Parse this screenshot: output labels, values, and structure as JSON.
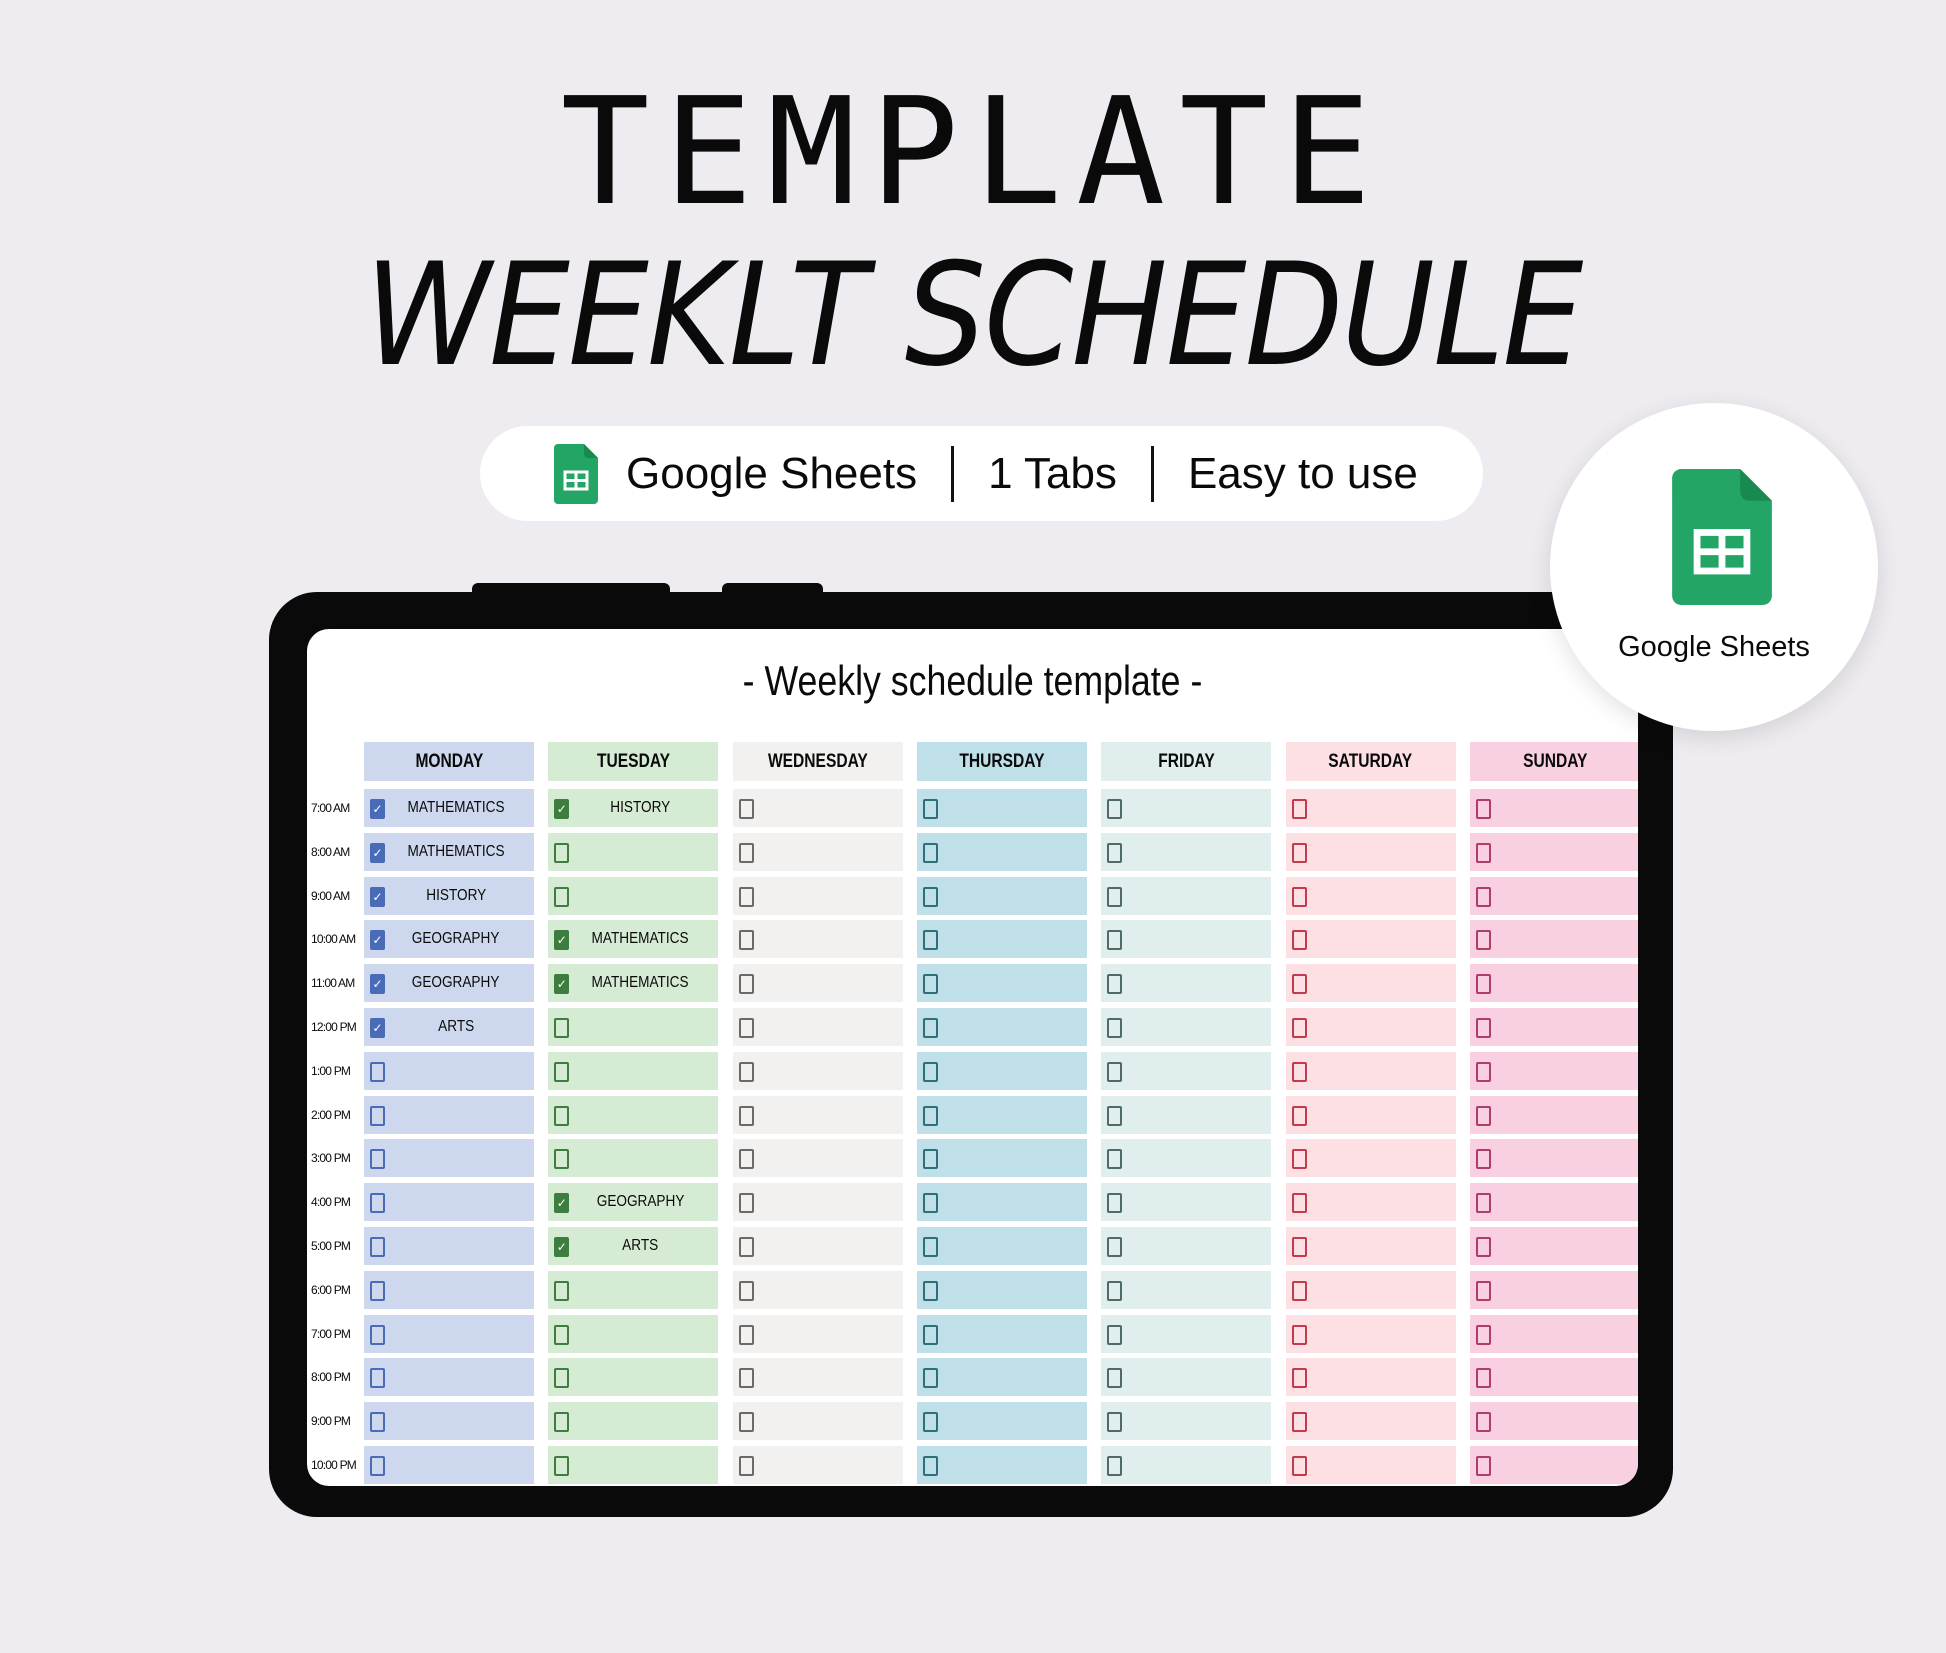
{
  "headline": {
    "line1": "TEMPLATE",
    "line2": "WEEKLT SCHEDULE"
  },
  "features": [
    {
      "icon": "google-sheets-icon",
      "label": "Google Sheets"
    },
    {
      "label": "1 Tabs"
    },
    {
      "label": "Easy to use"
    }
  ],
  "badge": {
    "icon": "google-sheets-icon",
    "label": "Google Sheets"
  },
  "colors": {
    "background": "#efecf1",
    "sheets_green": "#23a566",
    "device": "#0a0a0a"
  },
  "schedule": {
    "title": "- Weekly schedule template -",
    "days": [
      {
        "name": "MONDAY",
        "fill": "#cdd8ee",
        "box": "#4a6cb8"
      },
      {
        "name": "TUESDAY",
        "fill": "#d5ebd3",
        "box": "#3f7d3f"
      },
      {
        "name": "WEDNESDAY",
        "fill": "#f2f1ef",
        "box": "#6a6a6a"
      },
      {
        "name": "THURSDAY",
        "fill": "#bfe0e8",
        "box": "#2f6f7c"
      },
      {
        "name": "FRIDAY",
        "fill": "#e1eeee",
        "box": "#4f6b69"
      },
      {
        "name": "SATURDAY",
        "fill": "#fde0e3",
        "box": "#c23a4b"
      },
      {
        "name": "SUNDAY",
        "fill": "#f9d0e1",
        "box": "#b03c6c"
      }
    ],
    "times": [
      "7:00 AM",
      "8:00 AM",
      "9:00 AM",
      "10:00 AM",
      "11:00 AM",
      "12:00 PM",
      "1:00 PM",
      "2:00 PM",
      "3:00 PM",
      "4:00 PM",
      "5:00 PM",
      "6:00 PM",
      "7:00 PM",
      "8:00 PM",
      "9:00 PM",
      "10:00 PM"
    ],
    "entries": [
      {
        "day": 0,
        "row": 0,
        "subject": "MATHEMATICS",
        "checked": true
      },
      {
        "day": 0,
        "row": 1,
        "subject": "MATHEMATICS",
        "checked": true
      },
      {
        "day": 0,
        "row": 2,
        "subject": "HISTORY",
        "checked": true
      },
      {
        "day": 0,
        "row": 3,
        "subject": "GEOGRAPHY",
        "checked": true
      },
      {
        "day": 0,
        "row": 4,
        "subject": "GEOGRAPHY",
        "checked": true
      },
      {
        "day": 0,
        "row": 5,
        "subject": "ARTS",
        "checked": true
      },
      {
        "day": 1,
        "row": 0,
        "subject": "HISTORY",
        "checked": true
      },
      {
        "day": 1,
        "row": 3,
        "subject": "MATHEMATICS",
        "checked": true
      },
      {
        "day": 1,
        "row": 4,
        "subject": "MATHEMATICS",
        "checked": true
      },
      {
        "day": 1,
        "row": 9,
        "subject": "GEOGRAPHY",
        "checked": true
      },
      {
        "day": 1,
        "row": 10,
        "subject": "ARTS",
        "checked": true
      }
    ]
  }
}
